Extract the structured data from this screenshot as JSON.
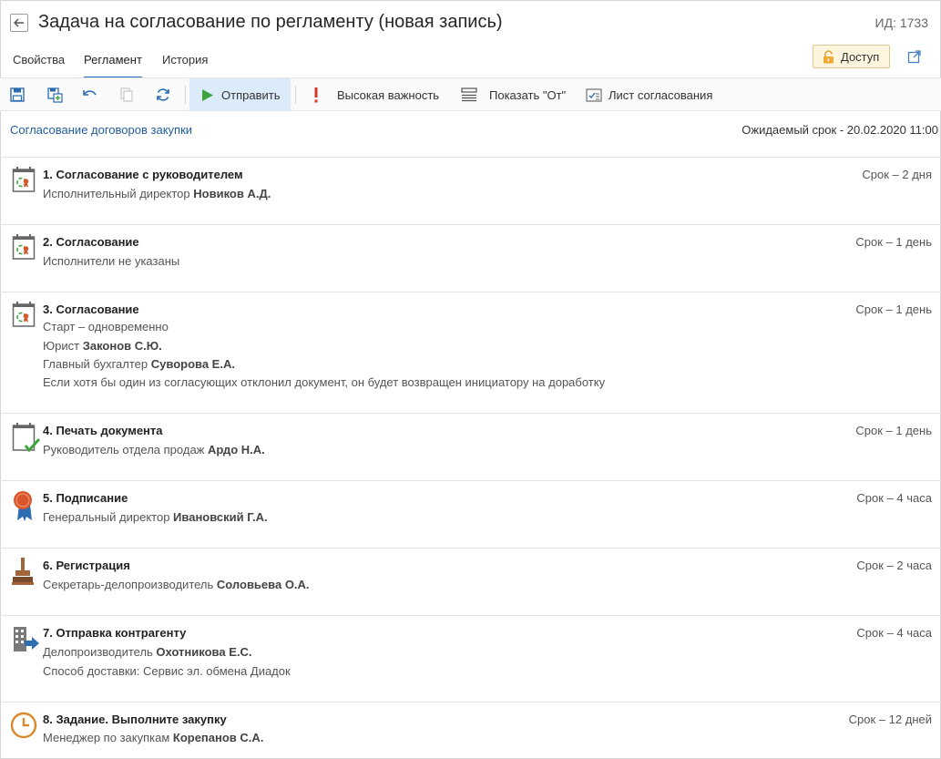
{
  "header": {
    "title": "Задача на согласование по регламенту (новая запись)",
    "record_id": "ИД: 1733",
    "back_icon": "arrow-left-icon"
  },
  "tabs": [
    {
      "label": "Свойства",
      "active": false
    },
    {
      "label": "Регламент",
      "active": true
    },
    {
      "label": "История",
      "active": false
    }
  ],
  "access_button": {
    "label": "Доступ",
    "icon": "lock-icon"
  },
  "toolbar": {
    "send_label": "Отправить",
    "importance_label": "Высокая важность",
    "show_from_label": "Показать \"От\"",
    "approval_sheet_label": "Лист согласования"
  },
  "process": {
    "name": "Согласование договоров закупки",
    "deadline": "Ожидаемый срок - 20.02.2020 11:00"
  },
  "steps": [
    {
      "title": "1. Согласование с руководителем",
      "term": "Срок – 2 дня",
      "icon": "approval-calendar-icon",
      "lines": [
        {
          "prefix": "Исполнительный директор ",
          "bold": "Новиков А.Д."
        }
      ]
    },
    {
      "title": "2. Согласование",
      "term": "Срок – 1 день",
      "icon": "approval-calendar-icon",
      "lines": [
        {
          "prefix": "Исполнители не указаны",
          "bold": ""
        }
      ]
    },
    {
      "title": "3. Согласование",
      "term": "Срок – 1 день",
      "icon": "approval-calendar-icon",
      "lines": [
        {
          "prefix": "Старт – одновременно",
          "bold": ""
        },
        {
          "prefix": "Юрист ",
          "bold": "Законов С.Ю."
        },
        {
          "prefix": "Главный бухгалтер ",
          "bold": "Суворова Е.А."
        },
        {
          "prefix": "Если хотя бы один из согласующих отклонил документ, он будет возвращен инициатору на доработку",
          "bold": ""
        }
      ]
    },
    {
      "title": "4. Печать документа",
      "term": "Срок – 1 день",
      "icon": "print-check-icon",
      "lines": [
        {
          "prefix": "Руководитель отдела продаж ",
          "bold": "Ардо Н.А."
        }
      ]
    },
    {
      "title": "5. Подписание",
      "term": "Срок – 4 часа",
      "icon": "seal-ribbon-icon",
      "lines": [
        {
          "prefix": "Генеральный директор ",
          "bold": "Ивановский Г.А."
        }
      ]
    },
    {
      "title": "6. Регистрация",
      "term": "Срок – 2 часа",
      "icon": "stamp-icon",
      "lines": [
        {
          "prefix": "Секретарь-делопроизводитель ",
          "bold": "Соловьева О.А."
        }
      ]
    },
    {
      "title": "7. Отправка контрагенту",
      "term": "Срок – 4 часа",
      "icon": "building-send-icon",
      "lines": [
        {
          "prefix": "Делопроизводитель ",
          "bold": "Охотникова Е.С."
        },
        {
          "prefix": "Способ доставки: Сервис эл. обмена  Диадок",
          "bold": ""
        }
      ]
    },
    {
      "title": "8. Задание. Выполните закупку",
      "term": "Срок – 12 дней",
      "icon": "clock-icon",
      "lines": [
        {
          "prefix": "Менеджер по закупкам ",
          "bold": "Корепанов С.А."
        }
      ]
    }
  ]
}
